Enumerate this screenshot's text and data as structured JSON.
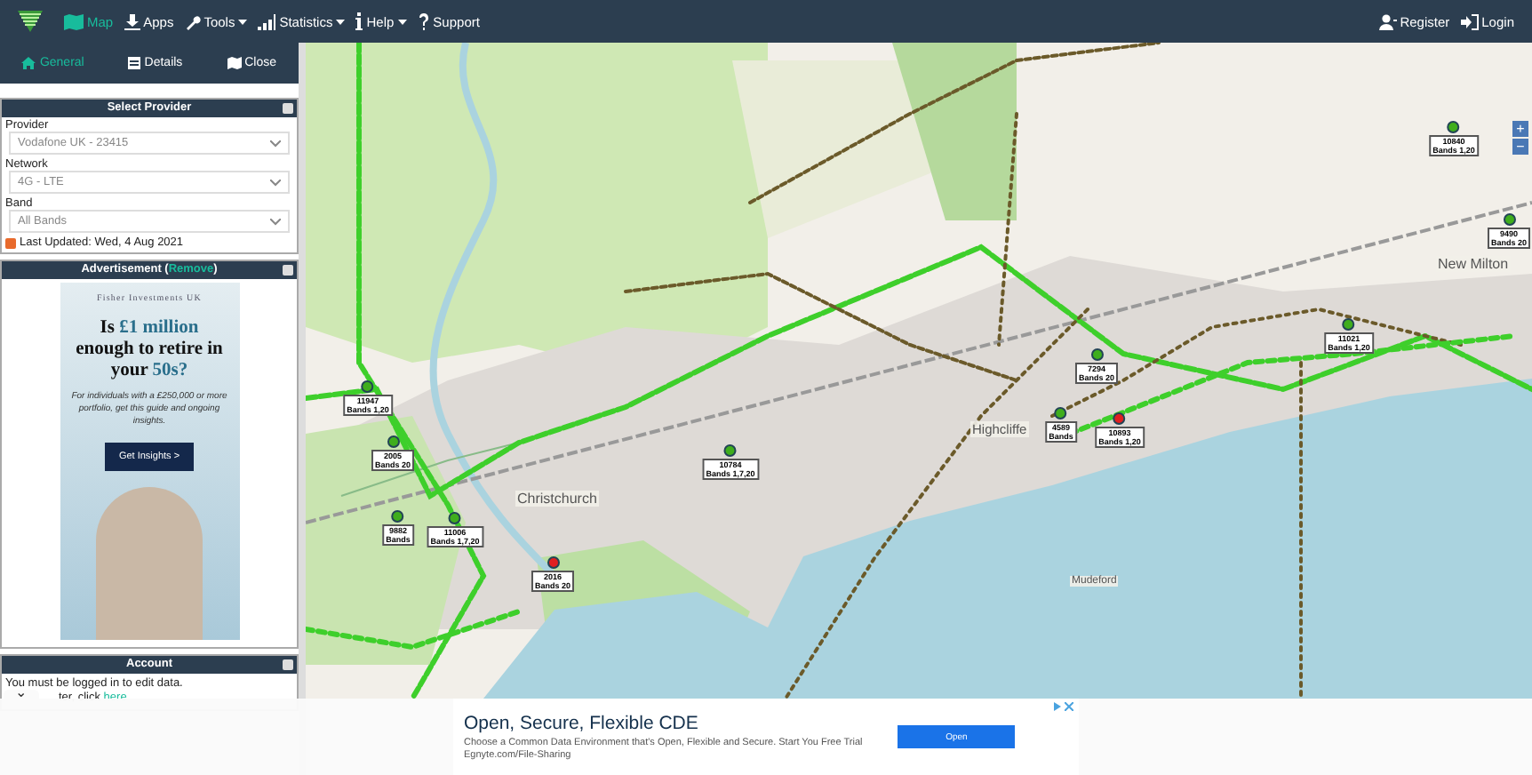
{
  "navbar": {
    "menu": [
      {
        "label": "Map",
        "selected": true,
        "caret": false
      },
      {
        "label": "Apps",
        "selected": false,
        "caret": false
      },
      {
        "label": "Tools",
        "selected": false,
        "caret": true
      },
      {
        "label": "Statistics",
        "selected": false,
        "caret": true
      },
      {
        "label": "Help",
        "selected": false,
        "caret": true
      },
      {
        "label": "Support",
        "selected": false,
        "caret": false
      }
    ],
    "right": [
      {
        "label": "Register"
      },
      {
        "label": "Login"
      }
    ]
  },
  "sidebar": {
    "tabs": [
      {
        "label": "General",
        "selected": true
      },
      {
        "label": "Details",
        "selected": false
      },
      {
        "label": "Close",
        "selected": false
      }
    ],
    "provider_panel": {
      "title": "Select Provider",
      "fields": [
        {
          "label": "Provider",
          "value": "Vodafone UK - 23415"
        },
        {
          "label": "Network",
          "value": "4G - LTE"
        },
        {
          "label": "Band",
          "value": "All Bands"
        }
      ],
      "last_updated": "Last Updated: Wed, 4 Aug 2021"
    },
    "ad_panel": {
      "title_before": "Advertisement (",
      "link": "Remove",
      "title_after": ")",
      "ad": {
        "brand": "Fisher Investments UK",
        "headline": [
          {
            "text": "Is ",
            "accent": false
          },
          {
            "text": "£1 million",
            "accent": true
          },
          {
            "text": " enough to retire in your ",
            "accent": false
          },
          {
            "text": "50s?",
            "accent": true
          }
        ],
        "body": "For individuals with a £250,000 or more portfolio, get this guide and ongoing insights.",
        "button": "Get Insights >"
      }
    },
    "account_panel": {
      "title": "Account",
      "text": "You must be logged in to edit data.",
      "text2": "ter, click ",
      "link": "here"
    }
  },
  "map": {
    "places": [
      "Christchurch",
      "Highcliffe",
      "New Milton",
      "Mudeford"
    ],
    "markers": [
      {
        "id": "11947",
        "bands": "Bands 1,20",
        "color": "#3fae1d"
      },
      {
        "id": "2005",
        "bands": "Bands 20",
        "color": "#3fae1d"
      },
      {
        "id": "9882",
        "bands": "Bands",
        "color": "#3fae1d"
      },
      {
        "id": "11006",
        "bands": "Bands 1,7,20",
        "color": "#3fae1d"
      },
      {
        "id": "2016",
        "bands": "Bands 20",
        "color": "#e02020"
      },
      {
        "id": "10784",
        "bands": "Bands 1,7,20",
        "color": "#3fae1d"
      },
      {
        "id": "7294",
        "bands": "Bands 20",
        "color": "#3fae1d"
      },
      {
        "id": "4589",
        "bands": "Bands",
        "color": "#3fae1d"
      },
      {
        "id": "10893",
        "bands": "Bands 1,20",
        "color": "#e02020"
      },
      {
        "id": "11021",
        "bands": "Bands 1,20",
        "color": "#3fae1d"
      },
      {
        "id": "10840",
        "bands": "Bands 1,20",
        "color": "#3fae1d"
      },
      {
        "id": "9490",
        "bands": "Bands 20",
        "color": "#3fae1d"
      }
    ],
    "zoom": [
      "+",
      "−"
    ]
  },
  "banner": {
    "title": "Open, Secure, Flexible CDE",
    "body": "Choose a Common Data Environment that's Open, Flexible and Secure. Start You Free Trial",
    "url": "Egnyte.com/File-Sharing",
    "button": "Open",
    "collapse": "⌄"
  }
}
